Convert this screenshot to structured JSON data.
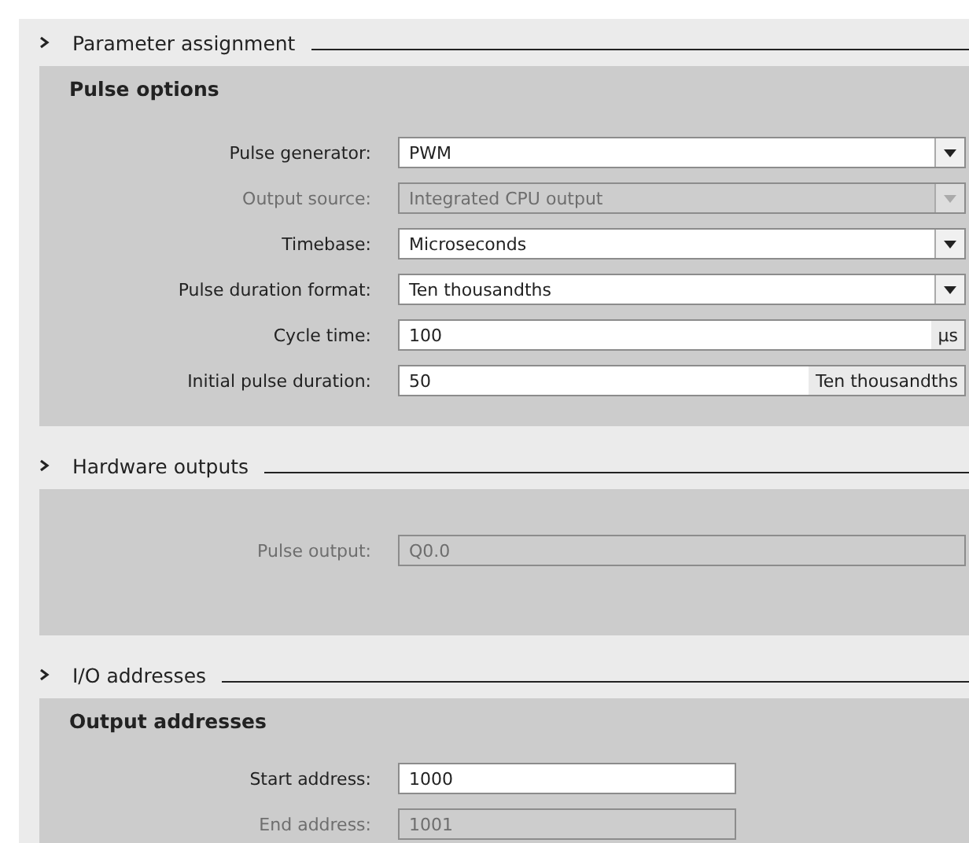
{
  "sections": [
    {
      "title": "Parameter assignment",
      "groups": [
        {
          "title": "Pulse options",
          "rows": [
            {
              "label": "Pulse generator:",
              "kind": "dropdown",
              "value": "PWM",
              "disabled": false
            },
            {
              "label": "Output source:",
              "kind": "dropdown",
              "value": "Integrated CPU output",
              "disabled": true
            },
            {
              "label": "Timebase:",
              "kind": "dropdown",
              "value": "Microseconds",
              "disabled": false
            },
            {
              "label": "Pulse duration format:",
              "kind": "dropdown",
              "value": "Ten thousandths",
              "disabled": false
            },
            {
              "label": "Cycle time:",
              "kind": "text",
              "value": "100",
              "unit": "µs",
              "disabled": false
            },
            {
              "label": "Initial pulse duration:",
              "kind": "text",
              "value": "50",
              "unit": "Ten thousandths",
              "disabled": false
            }
          ]
        }
      ]
    },
    {
      "title": "Hardware outputs",
      "groups": [
        {
          "rows": [
            {
              "label": "Pulse output:",
              "kind": "text",
              "value": "Q0.0",
              "disabled": true
            }
          ]
        }
      ]
    },
    {
      "title": "I/O addresses",
      "groups": [
        {
          "title": "Output addresses",
          "rows": [
            {
              "label": "Start address:",
              "kind": "short",
              "value": "1000",
              "disabled": false
            },
            {
              "label": "End address:",
              "kind": "short",
              "value": "1001",
              "disabled": true
            }
          ]
        }
      ]
    }
  ]
}
